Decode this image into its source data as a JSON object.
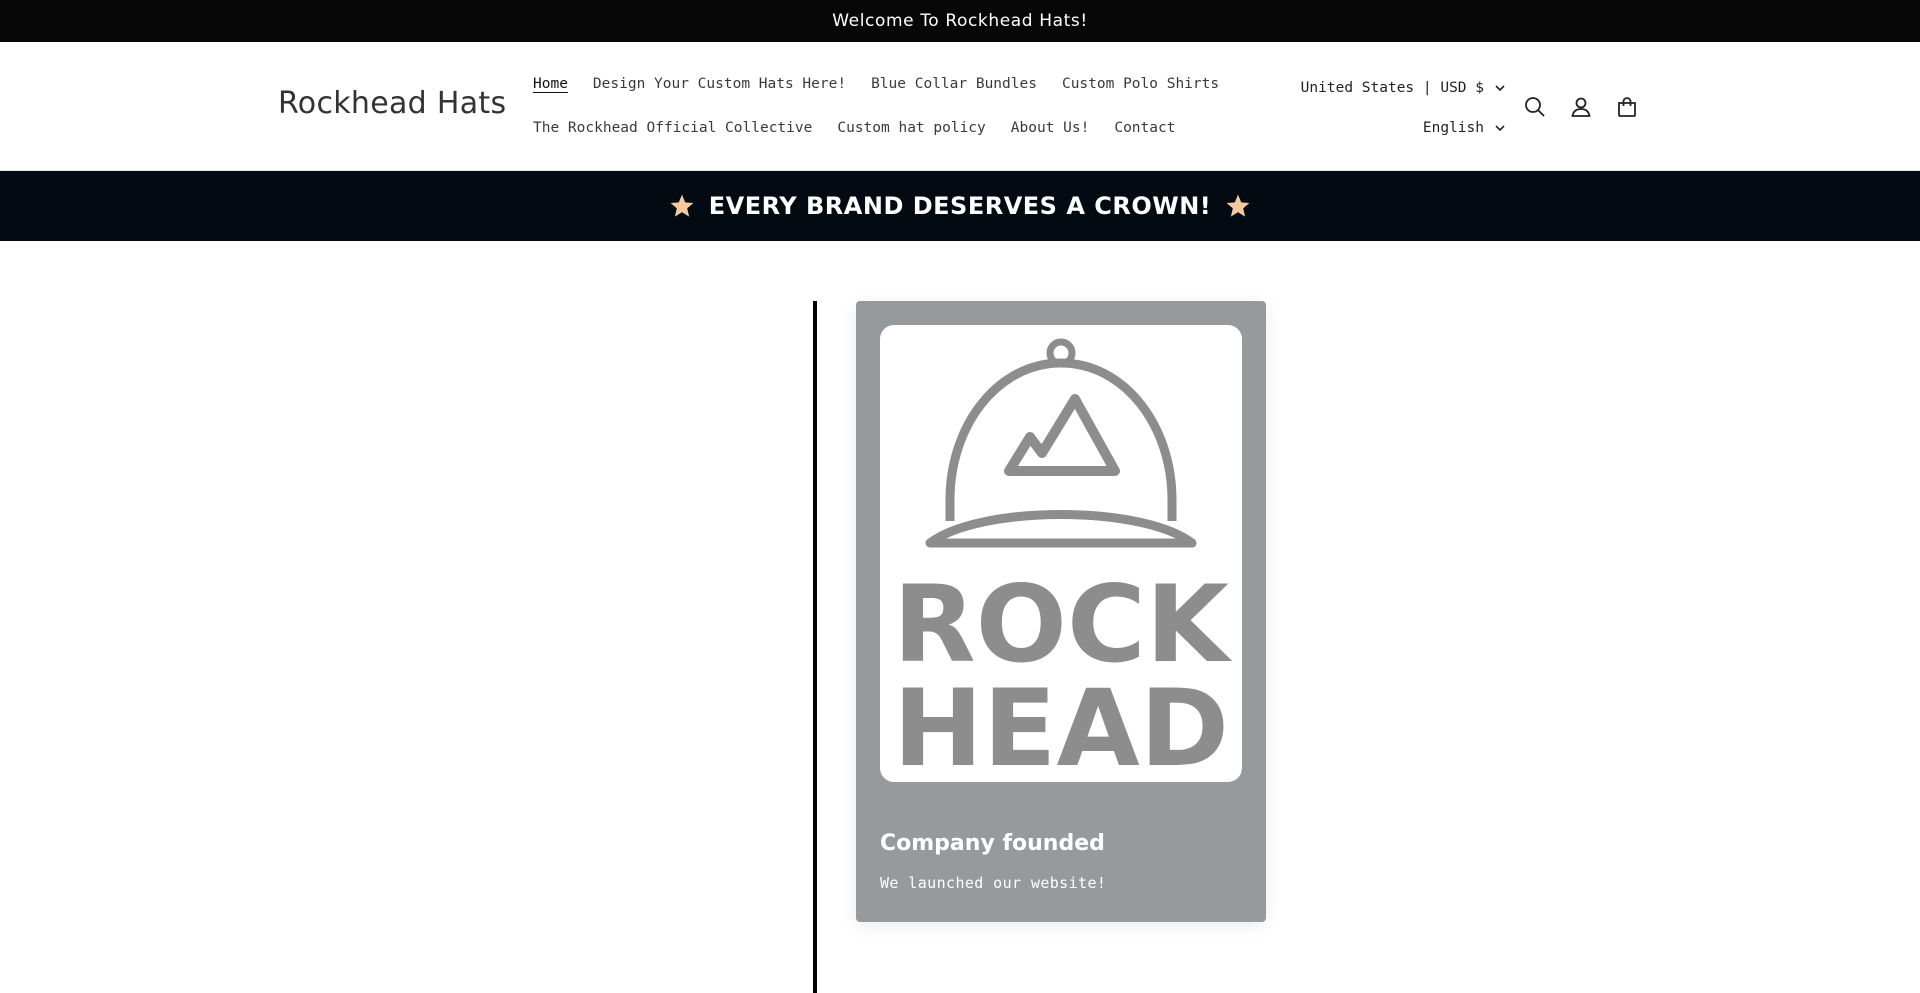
{
  "announcement": {
    "text": "Welcome To Rockhead Hats!"
  },
  "header": {
    "logo": "Rockhead Hats",
    "nav_row1": [
      "Home",
      "Design Your Custom Hats Here!",
      "Blue Collar Bundles",
      "Custom Polo Shirts"
    ],
    "nav_row2": [
      "The Rockhead Official Collective",
      "Custom hat policy",
      "About Us!",
      "Contact"
    ],
    "country": "United States | USD $",
    "language": "English",
    "icons": [
      "search-icon",
      "account-icon",
      "cart-icon"
    ]
  },
  "slogan": {
    "text": "EVERY BRAND DESERVES A CROWN!"
  },
  "timeline": {
    "card": {
      "logo_text_line1": "ROCK",
      "logo_text_line2": "HEAD",
      "title": "Company founded",
      "text": "We launched our website!"
    }
  },
  "colors": {
    "announcement_bg": "#070707",
    "slogan_bg": "#030a12",
    "card_bg": "#979a9d",
    "star": "#f5c9a0",
    "logo_gray": "#8d8d8d"
  }
}
